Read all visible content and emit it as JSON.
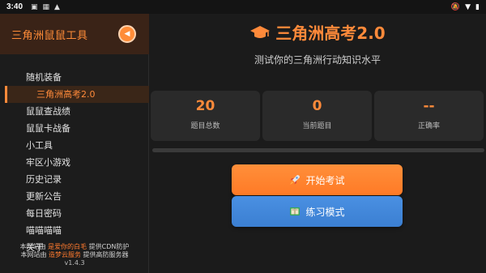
{
  "status_bar": {
    "time": "3:40",
    "icons": [
      "notification-icon",
      "image-icon",
      "a-icon"
    ],
    "right_icons": [
      "mute-icon",
      "wifi-icon",
      "battery-icon"
    ]
  },
  "sidebar": {
    "title": "三角洲鼠鼠工具",
    "collapse_icon": "chevron-left-icon",
    "items": [
      {
        "label": "随机装备",
        "active": false
      },
      {
        "label": "三角洲高考2.0",
        "active": true
      },
      {
        "label": "鼠鼠查战绩",
        "active": false
      },
      {
        "label": "鼠鼠卡战备",
        "active": false
      },
      {
        "label": "小工具",
        "active": false
      },
      {
        "label": "牢区小游戏",
        "active": false
      },
      {
        "label": "历史记录",
        "active": false
      },
      {
        "label": "更新公告",
        "active": false
      },
      {
        "label": "每日密码",
        "active": false
      },
      {
        "label": "喵喵喵喵",
        "active": false
      },
      {
        "label": "关于",
        "active": false
      }
    ],
    "footer": {
      "line1_prefix": "本网站由",
      "line1_highlight": "是爱你的白毛",
      "line1_suffix": "提供CDN防护",
      "line2_prefix": "本网站由",
      "line2_highlight": "造梦云服务",
      "line2_suffix": "提供高防服务器",
      "version": "v1.4.3"
    }
  },
  "main": {
    "title": "三角洲高考2.0",
    "title_icon": "graduation-cap-icon",
    "subtitle": "测试你的三角洲行动知识水平",
    "stats": [
      {
        "value": "20",
        "label": "题目总数"
      },
      {
        "value": "0",
        "label": "当前题目"
      },
      {
        "value": "--",
        "label": "正确率"
      }
    ],
    "progress": 0,
    "start_button": {
      "label": "开始考试",
      "icon": "rocket-icon"
    },
    "practice_button": {
      "label": "练习模式",
      "icon": "book-icon"
    }
  },
  "colors": {
    "accent": "#ff8a3a",
    "practice_blue": "#4a90e2",
    "background": "#1b1b1b",
    "card": "#2a2a2a"
  }
}
